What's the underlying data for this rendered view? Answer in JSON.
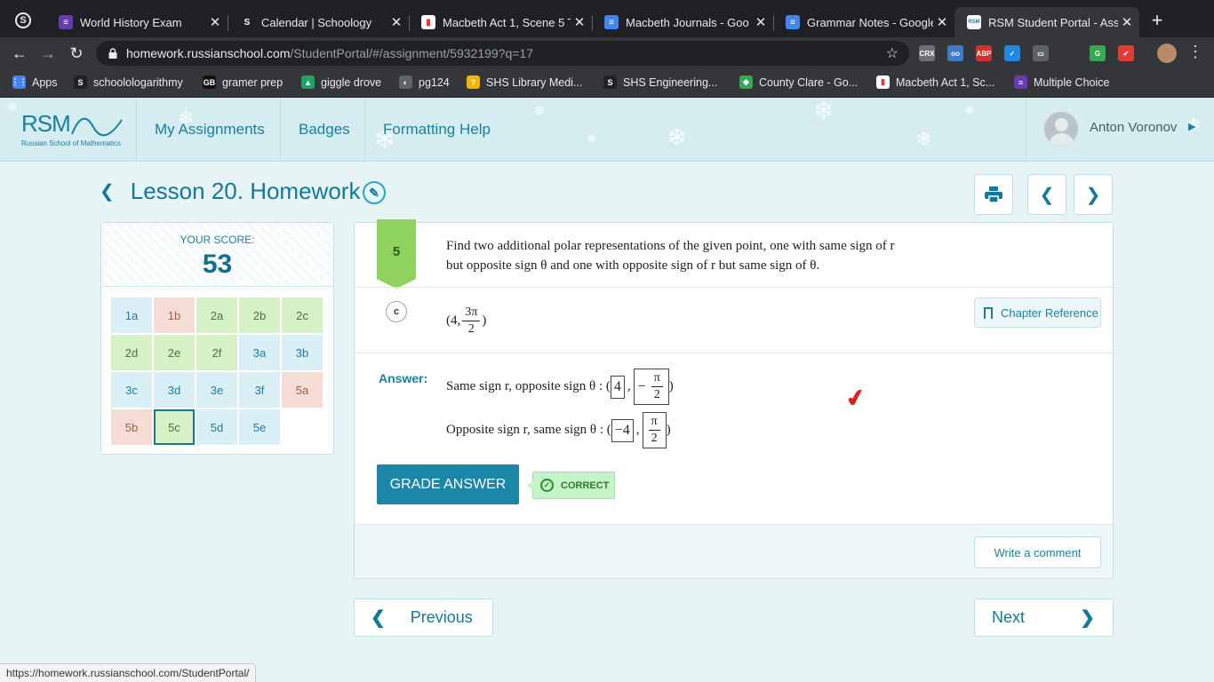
{
  "browser": {
    "tabs": [
      {
        "title": "World History Exam",
        "icon": "forms-icon",
        "color": "#673ab7",
        "glyph": "≡"
      },
      {
        "title": "Calendar | Schoology",
        "icon": "schoology-icon",
        "color": "#202124",
        "glyph": "S"
      },
      {
        "title": "Macbeth Act 1, Scene 5 T",
        "icon": "chart-icon",
        "color": "#ffffff",
        "glyph": "▮"
      },
      {
        "title": "Macbeth Journals - Goo",
        "icon": "docs-icon",
        "color": "#4285f4",
        "glyph": "≡"
      },
      {
        "title": "Grammar Notes - Google",
        "icon": "docs-icon",
        "color": "#4285f4",
        "glyph": "≡"
      },
      {
        "title": "RSM Student Portal - Ass",
        "icon": "rsm-icon",
        "color": "#ffffff",
        "glyph": "RSM"
      }
    ],
    "url_host": "homework.russianschool.com",
    "url_path": "/StudentPortal/#/assignment/5932199?q=17",
    "extensions": [
      {
        "label": "CRX",
        "color": "#6d6f72"
      },
      {
        "label": "oo",
        "color": "#3d7dc8"
      },
      {
        "label": "ABP",
        "color": "#d32f2f"
      },
      {
        "label": "✓",
        "color": "#1e88e5"
      },
      {
        "label": "▭",
        "color": "#5f6368"
      },
      {
        "label": "G",
        "color": "#34a853"
      },
      {
        "label": "✔",
        "color": "#e53935"
      }
    ],
    "bookmarks": [
      {
        "label": "Apps",
        "color": "#4285f4",
        "glyph": "⋮⋮"
      },
      {
        "label": "schoolologarithmy",
        "color": "#202124",
        "glyph": "S"
      },
      {
        "label": "gramer prep",
        "color": "#111111",
        "glyph": "GB"
      },
      {
        "label": "giggle drove",
        "color": "#1fa463",
        "glyph": "▲"
      },
      {
        "label": "pg124",
        "color": "#5f6368",
        "glyph": "◐"
      },
      {
        "label": "SHS Library Medi...",
        "color": "#f4b400",
        "glyph": "?"
      },
      {
        "label": "SHS Engineering...",
        "color": "#202124",
        "glyph": "S"
      },
      {
        "label": "County Clare - Go...",
        "color": "#34a853",
        "glyph": "◆"
      },
      {
        "label": "Macbeth Act 1, Sc...",
        "color": "#ffffff",
        "glyph": "▮"
      },
      {
        "label": "Multiple Choice",
        "color": "#673ab7",
        "glyph": "≡"
      }
    ],
    "status_url": "https://homework.russianschool.com/StudentPortal/"
  },
  "site": {
    "logo": "RSM",
    "logo_sub": "Russian School of Mathematics",
    "nav": [
      "My Assignments",
      "Badges",
      "Formatting Help"
    ],
    "user_name": "Anton Voronov"
  },
  "lesson": {
    "title": "Lesson 20. Homework"
  },
  "score": {
    "label": "YOUR SCORE:",
    "value": "53",
    "cells": [
      {
        "label": "1a",
        "status": "blue"
      },
      {
        "label": "1b",
        "status": "red"
      },
      {
        "label": "2a",
        "status": "green"
      },
      {
        "label": "2b",
        "status": "green"
      },
      {
        "label": "2c",
        "status": "green"
      },
      {
        "label": "2d",
        "status": "green"
      },
      {
        "label": "2e",
        "status": "green"
      },
      {
        "label": "2f",
        "status": "green"
      },
      {
        "label": "3a",
        "status": "blue"
      },
      {
        "label": "3b",
        "status": "blue"
      },
      {
        "label": "3c",
        "status": "blue"
      },
      {
        "label": "3d",
        "status": "blue"
      },
      {
        "label": "3e",
        "status": "blue"
      },
      {
        "label": "3f",
        "status": "blue"
      },
      {
        "label": "5a",
        "status": "red"
      },
      {
        "label": "5b",
        "status": "red"
      },
      {
        "label": "5c",
        "status": "current"
      },
      {
        "label": "5d",
        "status": "blue"
      },
      {
        "label": "5e",
        "status": "blue"
      }
    ]
  },
  "question": {
    "number": "5",
    "text_line1": "Find two additional polar representations of the given point, one with same sign of r",
    "text_line2": "but opposite sign θ and one with opposite sign of r but same sign of θ.",
    "part": "c",
    "point_open": "(4,",
    "point_num": "3π",
    "point_den": "2",
    "point_close": ")",
    "chapter_ref": "Chapter Reference",
    "answer_label": "Answer:",
    "line1_text": "Same sign r, opposite sign θ : (",
    "line1_val1": "4",
    "line1_comma": ",",
    "line1_sign": "−",
    "line1_num": "π",
    "line1_den": "2",
    "line1_close": ")",
    "line2_text": "Opposite sign r, same sign θ : (",
    "line2_val1": "−4",
    "line2_comma": ",",
    "line2_num": "π",
    "line2_den": "2",
    "line2_close": ")",
    "grade_button": "GRADE ANSWER",
    "result": "CORRECT",
    "comment_button": "Write a comment"
  },
  "pager": {
    "previous": "Previous",
    "next": "Next"
  }
}
